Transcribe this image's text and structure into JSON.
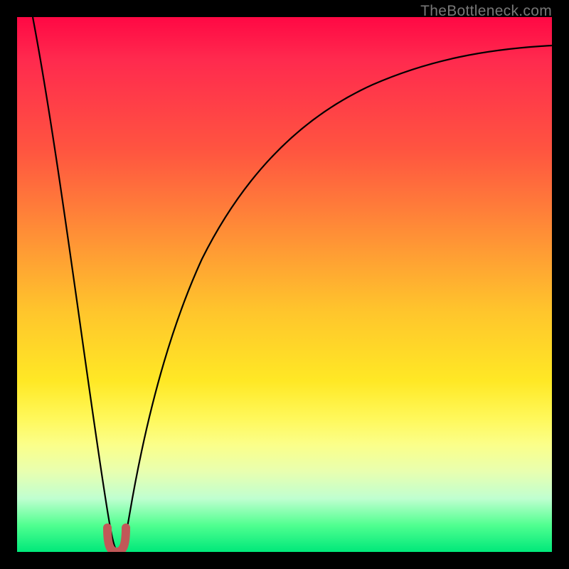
{
  "watermark_text": "TheBottleneck.com",
  "chart_data": {
    "type": "line",
    "title": "",
    "xlabel": "",
    "ylabel": "",
    "xlim": [
      0,
      100
    ],
    "ylim": [
      0,
      100
    ],
    "series": [
      {
        "name": "bottleneck-curve",
        "x": [
          3,
          5,
          8,
          10,
          12,
          14,
          16,
          17,
          18,
          19,
          20,
          21,
          22,
          23,
          25,
          28,
          32,
          38,
          45,
          55,
          65,
          78,
          90,
          100
        ],
        "y": [
          100,
          78,
          55,
          40,
          28,
          15,
          6,
          2,
          0,
          0,
          2,
          6,
          12,
          20,
          33,
          47,
          58,
          68,
          76,
          82,
          86,
          89,
          91,
          92
        ]
      },
      {
        "name": "optimal-marker",
        "x": [
          17,
          17.5,
          18,
          18.5,
          19,
          19.5,
          20
        ],
        "y": [
          4,
          1,
          0,
          0.5,
          0,
          1,
          4
        ]
      }
    ],
    "gradient_stops": [
      {
        "pos": 0,
        "color": "#ff0844"
      },
      {
        "pos": 25,
        "color": "#ff5540"
      },
      {
        "pos": 50,
        "color": "#ffc52c"
      },
      {
        "pos": 75,
        "color": "#fff85a"
      },
      {
        "pos": 100,
        "color": "#00e87a"
      }
    ],
    "marker_color": "#c15858"
  }
}
